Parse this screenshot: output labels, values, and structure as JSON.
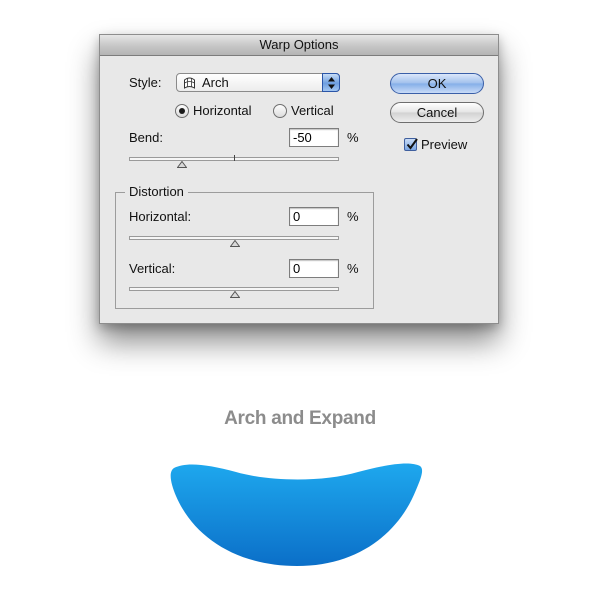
{
  "dialog": {
    "title": "Warp Options",
    "style": {
      "label": "Style:",
      "value": "Arch",
      "icon": "arch-style-icon"
    },
    "orientation": {
      "options": [
        "Horizontal",
        "Vertical"
      ],
      "selected": "Horizontal"
    },
    "bend": {
      "label": "Bend:",
      "value": "-50",
      "unit": "%",
      "slider_fraction": 0.25
    },
    "distortion": {
      "title": "Distortion",
      "horizontal": {
        "label": "Horizontal:",
        "value": "0",
        "unit": "%",
        "slider_fraction": 0.5
      },
      "vertical": {
        "label": "Vertical:",
        "value": "0",
        "unit": "%",
        "slider_fraction": 0.5
      }
    },
    "buttons": {
      "ok": "OK",
      "cancel": "Cancel"
    },
    "preview": {
      "label": "Preview",
      "checked": true
    }
  },
  "caption": "Arch and Expand",
  "colors": {
    "dialog_bg": "#e8e8e8",
    "accent_blue": "#6d9ee0",
    "shape_top": "#1ea8ee",
    "shape_bottom": "#0b6fc8",
    "caption": "#8c8c8c"
  }
}
